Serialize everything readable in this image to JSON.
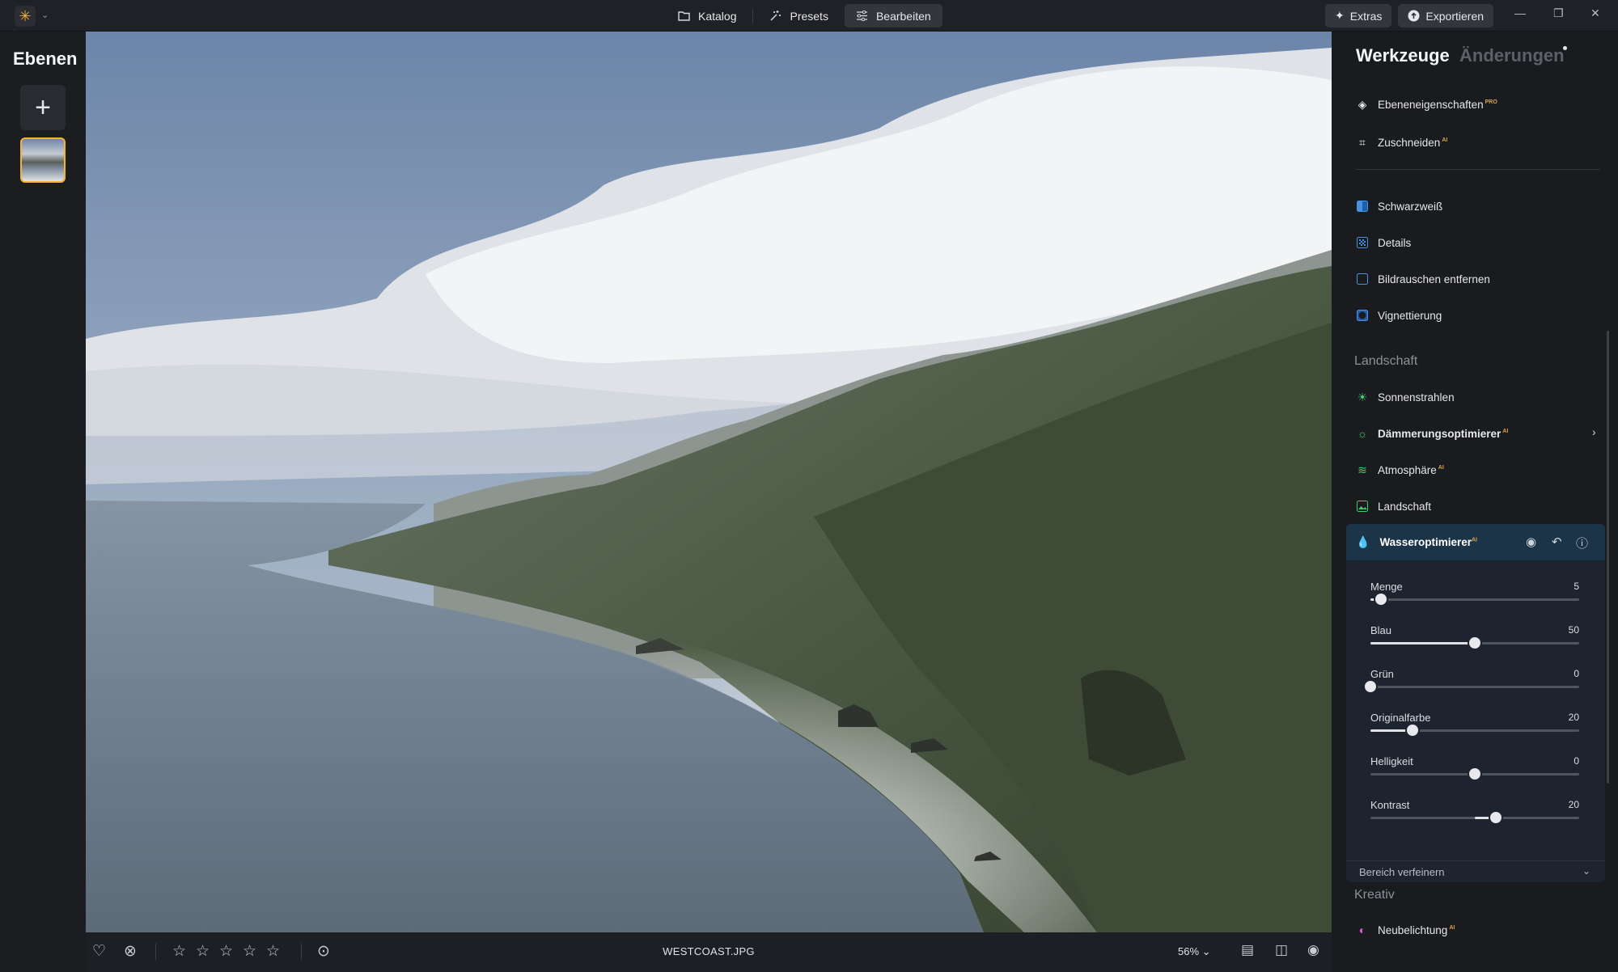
{
  "topbar": {
    "logo_glyph": "✳",
    "modes": [
      {
        "label": "Katalog",
        "icon": "folder-icon",
        "active": false
      },
      {
        "label": "Presets",
        "icon": "wand-icon",
        "active": false
      },
      {
        "label": "Bearbeiten",
        "icon": "sliders-icon",
        "active": true
      }
    ],
    "extras_label": "Extras",
    "export_label": "Exportieren"
  },
  "left_panel": {
    "title": "Ebenen",
    "add_glyph": "+"
  },
  "bottombar": {
    "filename": "WESTCOAST.JPG",
    "zoom": "56%"
  },
  "right_panel": {
    "tab_tools": "Werkzeuge",
    "tab_changes": "Änderungen",
    "tools_top": [
      {
        "label": "Ebeneneigenschaften",
        "badge": "PRO",
        "icon": "layers-icon"
      },
      {
        "label": "Zuschneiden",
        "badge": "AI",
        "icon": "crop-icon"
      }
    ],
    "tools_essential": [
      {
        "label": "Schwarzweiß",
        "icon": "bw-icon"
      },
      {
        "label": "Details",
        "icon": "details-icon"
      },
      {
        "label": "Bildrauschen entfernen",
        "icon": "denoise-icon"
      },
      {
        "label": "Vignettierung",
        "icon": "vignette-icon"
      }
    ],
    "section_landscape": "Landschaft",
    "tools_landscape": [
      {
        "label": "Sonnenstrahlen",
        "badge": "",
        "icon": "sunrays-icon"
      },
      {
        "label": "Dämmerungsoptimierer",
        "badge": "AI",
        "icon": "dusk-icon"
      },
      {
        "label": "Atmosphäre",
        "badge": "AI",
        "icon": "atmosphere-icon"
      },
      {
        "label": "Landschaft",
        "badge": "",
        "icon": "landscape-icon"
      }
    ],
    "water": {
      "title": "Wasseroptimierer",
      "badge": "AI",
      "sliders": [
        {
          "label": "Menge",
          "value": "5",
          "min": 0,
          "max": 100,
          "fraction": 0.05
        },
        {
          "label": "Blau",
          "value": "50",
          "min": 0,
          "max": 100,
          "fraction": 0.5
        },
        {
          "label": "Grün",
          "value": "0",
          "min": 0,
          "max": 100,
          "fraction": 0.0
        },
        {
          "label": "Originalfarbe",
          "value": "20",
          "min": 0,
          "max": 100,
          "fraction": 0.2
        },
        {
          "label": "Helligkeit",
          "value": "0",
          "min": -100,
          "max": 100,
          "fraction": 0.5
        },
        {
          "label": "Kontrast",
          "value": "20",
          "min": -100,
          "max": 100,
          "fraction": 0.6
        }
      ],
      "refine_label": "Bereich verfeinern"
    },
    "section_creative": "Kreativ",
    "tools_creative": [
      {
        "label": "Neubelichtung",
        "badge": "AI",
        "icon": "relight-icon"
      }
    ]
  },
  "colors": {
    "accent": "#f2b233",
    "panel_active": "#1c3448"
  }
}
